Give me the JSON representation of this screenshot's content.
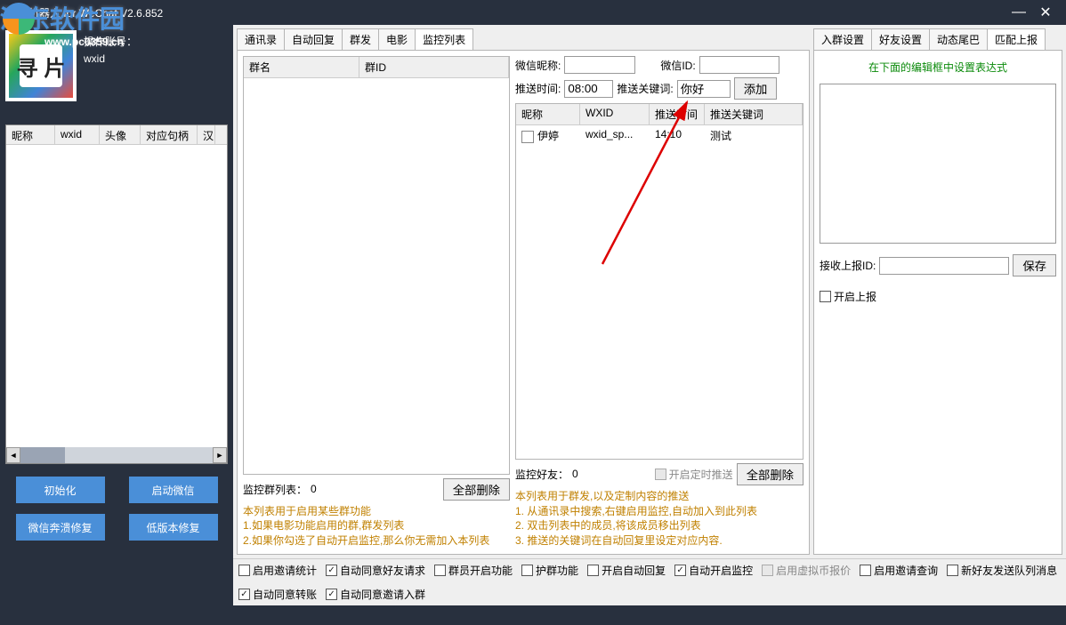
{
  "window": {
    "title": "寻片机器人 for WeChat V2.6.852",
    "minimize": "—",
    "close": "✕"
  },
  "watermark": {
    "text": "河东软件园",
    "url": "www.pc0359.cn"
  },
  "sidebar": {
    "account_label": "操作账号：",
    "wxid": "wxid",
    "avatar_text": "寻 片",
    "grid_headers": [
      "昵称",
      "wxid",
      "头像",
      "对应句柄",
      "汉"
    ],
    "buttons": {
      "init": "初始化",
      "start_wechat": "启动微信",
      "crash_fix": "微信奔溃修复",
      "low_version_fix": "低版本修复"
    }
  },
  "tabs_main": [
    "通讯录",
    "自动回复",
    "群发",
    "电影",
    "监控列表"
  ],
  "tabs_main_active": 4,
  "tabs_right": [
    "入群设置",
    "好友设置",
    "动态尾巴",
    "匹配上报"
  ],
  "tabs_right_active": 3,
  "monitor": {
    "left": {
      "headers": [
        "群名",
        "群ID"
      ],
      "count_label": "监控群列表：",
      "count": "0",
      "delete_all": "全部删除",
      "note": "本列表用于启用某些群功能\n1.如果电影功能启用的群,群发列表\n2.如果你勾选了自动开启监控,那么你无需加入本列表"
    },
    "right": {
      "nick_label": "微信昵称:",
      "nick_value": "",
      "wxid_label": "微信ID:",
      "wxid_value": "",
      "push_time_label": "推送时间:",
      "push_time_value": "08:00",
      "push_keyword_label": "推送关键词:",
      "push_keyword_value": "你好",
      "add_btn": "添加",
      "headers": [
        "昵称",
        "WXID",
        "推送时间",
        "推送关键词"
      ],
      "rows": [
        {
          "nick": "伊婷",
          "wxid": "wxid_sp...",
          "time": "14:10",
          "kw": "测试",
          "checked": false
        }
      ],
      "count_label": "监控好友：",
      "count": "0",
      "timer_label": "开启定时推送",
      "delete_all": "全部删除",
      "note": "本列表用于群发,以及定制内容的推送\n1. 从通讯录中搜索,右键启用监控,自动加入到此列表\n2. 双击列表中的成员,将该成员移出列表\n3. 推送的关键词在自动回复里设定对应内容."
    }
  },
  "match_report": {
    "hint": "在下面的编辑框中设置表达式",
    "recv_id_label": "接收上报ID:",
    "recv_id_value": "",
    "save_btn": "保存",
    "enable_label": "开启上报"
  },
  "footer": [
    {
      "label": "启用邀请统计",
      "checked": false,
      "disabled": false
    },
    {
      "label": "自动同意好友请求",
      "checked": true,
      "disabled": false
    },
    {
      "label": "群员开启功能",
      "checked": false,
      "disabled": false
    },
    {
      "label": "护群功能",
      "checked": false,
      "disabled": false
    },
    {
      "label": "开启自动回复",
      "checked": false,
      "disabled": false
    },
    {
      "label": "自动开启监控",
      "checked": true,
      "disabled": false
    },
    {
      "label": "启用虚拟币报价",
      "checked": false,
      "disabled": true
    },
    {
      "label": "启用邀请查询",
      "checked": false,
      "disabled": false
    },
    {
      "label": "新好友发送队列消息",
      "checked": false,
      "disabled": false
    },
    {
      "label": "自动同意转账",
      "checked": true,
      "disabled": false
    },
    {
      "label": "自动同意邀请入群",
      "checked": true,
      "disabled": false
    }
  ]
}
